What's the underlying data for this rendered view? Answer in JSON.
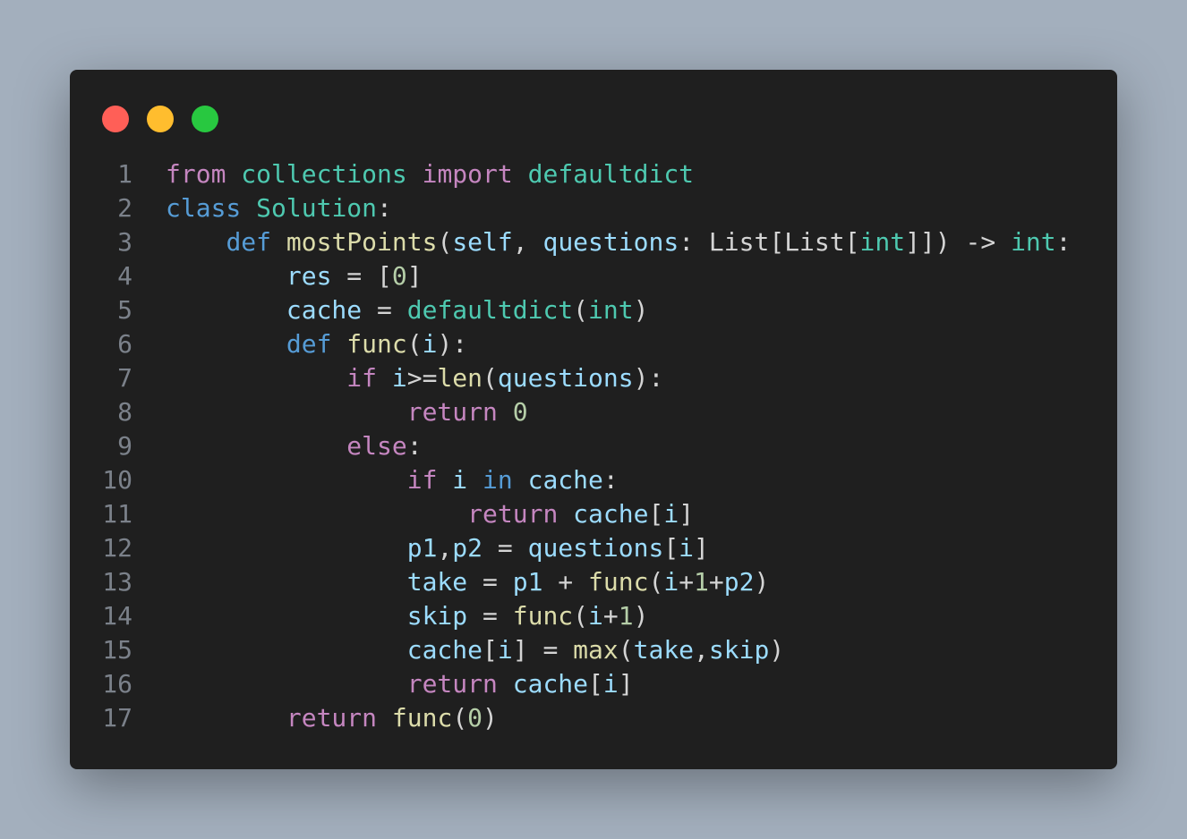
{
  "window": {
    "controls": {
      "close": {
        "color": "#ff5f57"
      },
      "minimize": {
        "color": "#ffbd2e"
      },
      "maximize": {
        "color": "#28c840"
      }
    }
  },
  "theme": {
    "background": "#1f1f1f",
    "page_background": "#a3afbd",
    "colors": {
      "kw": "#c586c0",
      "def": "#569cd6",
      "type": "#4ec9b0",
      "fn": "#dcdcaa",
      "var": "#9cdcfe",
      "num": "#b5cea8",
      "op": "#d4d4d4",
      "ln": "#7b818a"
    }
  },
  "code": {
    "lines": [
      {
        "n": "1",
        "tokens": [
          [
            "from",
            "kw"
          ],
          [
            " ",
            "op"
          ],
          [
            "collections",
            "type"
          ],
          [
            " ",
            "op"
          ],
          [
            "import",
            "kw"
          ],
          [
            " ",
            "op"
          ],
          [
            "defaultdict",
            "type"
          ]
        ]
      },
      {
        "n": "2",
        "tokens": [
          [
            "class",
            "def"
          ],
          [
            " ",
            "op"
          ],
          [
            "Solution",
            "type"
          ],
          [
            ":",
            "op"
          ]
        ]
      },
      {
        "n": "3",
        "tokens": [
          [
            "    ",
            "op"
          ],
          [
            "def",
            "def"
          ],
          [
            " ",
            "op"
          ],
          [
            "mostPoints",
            "fn"
          ],
          [
            "(",
            "op"
          ],
          [
            "self",
            "var"
          ],
          [
            ", ",
            "op"
          ],
          [
            "questions",
            "var"
          ],
          [
            ": List[List[",
            "op"
          ],
          [
            "int",
            "type"
          ],
          [
            "]]) -> ",
            "op"
          ],
          [
            "int",
            "type"
          ],
          [
            ":",
            "op"
          ]
        ]
      },
      {
        "n": "4",
        "tokens": [
          [
            "        ",
            "op"
          ],
          [
            "res",
            "var"
          ],
          [
            " = [",
            "op"
          ],
          [
            "0",
            "num"
          ],
          [
            "]",
            "op"
          ]
        ]
      },
      {
        "n": "5",
        "tokens": [
          [
            "        ",
            "op"
          ],
          [
            "cache",
            "var"
          ],
          [
            " = ",
            "op"
          ],
          [
            "defaultdict",
            "type"
          ],
          [
            "(",
            "op"
          ],
          [
            "int",
            "type"
          ],
          [
            ")",
            "op"
          ]
        ]
      },
      {
        "n": "6",
        "tokens": [
          [
            "        ",
            "op"
          ],
          [
            "def",
            "def"
          ],
          [
            " ",
            "op"
          ],
          [
            "func",
            "fn"
          ],
          [
            "(",
            "op"
          ],
          [
            "i",
            "var"
          ],
          [
            "):",
            "op"
          ]
        ]
      },
      {
        "n": "7",
        "tokens": [
          [
            "            ",
            "op"
          ],
          [
            "if",
            "kw"
          ],
          [
            " ",
            "op"
          ],
          [
            "i",
            "var"
          ],
          [
            ">=",
            "op"
          ],
          [
            "len",
            "fn"
          ],
          [
            "(",
            "op"
          ],
          [
            "questions",
            "var"
          ],
          [
            "):",
            "op"
          ]
        ]
      },
      {
        "n": "8",
        "tokens": [
          [
            "                ",
            "op"
          ],
          [
            "return",
            "kw"
          ],
          [
            " ",
            "op"
          ],
          [
            "0",
            "num"
          ]
        ]
      },
      {
        "n": "9",
        "tokens": [
          [
            "            ",
            "op"
          ],
          [
            "else",
            "kw"
          ],
          [
            ":",
            "op"
          ]
        ]
      },
      {
        "n": "10",
        "tokens": [
          [
            "                ",
            "op"
          ],
          [
            "if",
            "kw"
          ],
          [
            " ",
            "op"
          ],
          [
            "i",
            "var"
          ],
          [
            " ",
            "op"
          ],
          [
            "in",
            "def"
          ],
          [
            " ",
            "op"
          ],
          [
            "cache",
            "var"
          ],
          [
            ":",
            "op"
          ]
        ]
      },
      {
        "n": "11",
        "tokens": [
          [
            "                    ",
            "op"
          ],
          [
            "return",
            "kw"
          ],
          [
            " ",
            "op"
          ],
          [
            "cache",
            "var"
          ],
          [
            "[",
            "op"
          ],
          [
            "i",
            "var"
          ],
          [
            "]",
            "op"
          ]
        ]
      },
      {
        "n": "12",
        "tokens": [
          [
            "                ",
            "op"
          ],
          [
            "p1",
            "var"
          ],
          [
            ",",
            "op"
          ],
          [
            "p2",
            "var"
          ],
          [
            " = ",
            "op"
          ],
          [
            "questions",
            "var"
          ],
          [
            "[",
            "op"
          ],
          [
            "i",
            "var"
          ],
          [
            "]",
            "op"
          ]
        ]
      },
      {
        "n": "13",
        "tokens": [
          [
            "                ",
            "op"
          ],
          [
            "take",
            "var"
          ],
          [
            " = ",
            "op"
          ],
          [
            "p1",
            "var"
          ],
          [
            " + ",
            "op"
          ],
          [
            "func",
            "fn"
          ],
          [
            "(",
            "op"
          ],
          [
            "i",
            "var"
          ],
          [
            "+",
            "op"
          ],
          [
            "1",
            "num"
          ],
          [
            "+",
            "op"
          ],
          [
            "p2",
            "var"
          ],
          [
            ")",
            "op"
          ]
        ]
      },
      {
        "n": "14",
        "tokens": [
          [
            "                ",
            "op"
          ],
          [
            "skip",
            "var"
          ],
          [
            " = ",
            "op"
          ],
          [
            "func",
            "fn"
          ],
          [
            "(",
            "op"
          ],
          [
            "i",
            "var"
          ],
          [
            "+",
            "op"
          ],
          [
            "1",
            "num"
          ],
          [
            ")",
            "op"
          ]
        ]
      },
      {
        "n": "15",
        "tokens": [
          [
            "                ",
            "op"
          ],
          [
            "cache",
            "var"
          ],
          [
            "[",
            "op"
          ],
          [
            "i",
            "var"
          ],
          [
            "] = ",
            "op"
          ],
          [
            "max",
            "fn"
          ],
          [
            "(",
            "op"
          ],
          [
            "take",
            "var"
          ],
          [
            ",",
            "op"
          ],
          [
            "skip",
            "var"
          ],
          [
            ")",
            "op"
          ]
        ]
      },
      {
        "n": "16",
        "tokens": [
          [
            "                ",
            "op"
          ],
          [
            "return",
            "kw"
          ],
          [
            " ",
            "op"
          ],
          [
            "cache",
            "var"
          ],
          [
            "[",
            "op"
          ],
          [
            "i",
            "var"
          ],
          [
            "]",
            "op"
          ]
        ]
      },
      {
        "n": "17",
        "tokens": [
          [
            "        ",
            "op"
          ],
          [
            "return",
            "kw"
          ],
          [
            " ",
            "op"
          ],
          [
            "func",
            "fn"
          ],
          [
            "(",
            "op"
          ],
          [
            "0",
            "num"
          ],
          [
            ")",
            "op"
          ]
        ]
      }
    ]
  }
}
